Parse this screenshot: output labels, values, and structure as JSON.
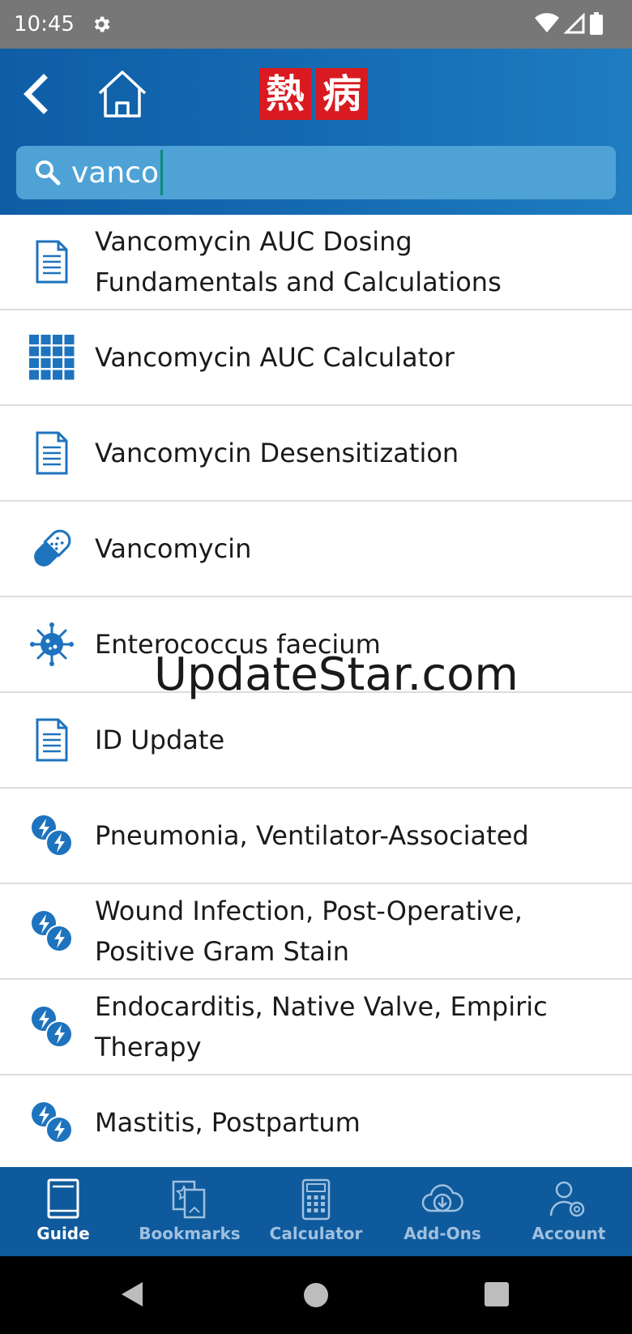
{
  "status_bar": {
    "time": "10:45"
  },
  "header": {
    "logo_chars": [
      "熱",
      "病"
    ],
    "search": {
      "value": "vanco"
    }
  },
  "results": [
    {
      "icon": "document-icon",
      "label": "Vancomycin AUC Dosing Fundamentals and Calculations"
    },
    {
      "icon": "calculator-grid-icon",
      "label": "Vancomycin AUC Calculator"
    },
    {
      "icon": "document-icon",
      "label": "Vancomycin Desensitization"
    },
    {
      "icon": "pill-icon",
      "label": "Vancomycin"
    },
    {
      "icon": "bacteria-icon",
      "label": "Enterococcus faecium"
    },
    {
      "icon": "document-icon",
      "label": "ID Update"
    },
    {
      "icon": "lightning-icon",
      "label": "Pneumonia, Ventilator-Associated"
    },
    {
      "icon": "lightning-icon",
      "label": "Wound Infection, Post-Operative, Positive Gram Stain"
    },
    {
      "icon": "lightning-icon",
      "label": "Endocarditis, Native Valve, Empiric Therapy"
    },
    {
      "icon": "lightning-icon",
      "label": "Mastitis, Postpartum"
    }
  ],
  "watermark": "UpdateStar.com",
  "bottom_nav": [
    {
      "icon": "book-icon",
      "label": "Guide",
      "active": true
    },
    {
      "icon": "bookmark-icon",
      "label": "Bookmarks",
      "active": false
    },
    {
      "icon": "calculator-icon",
      "label": "Calculator",
      "active": false
    },
    {
      "icon": "cloud-download-icon",
      "label": "Add-Ons",
      "active": false
    },
    {
      "icon": "account-gear-icon",
      "label": "Account",
      "active": false
    }
  ],
  "colors": {
    "header": "#1469b0",
    "nav": "#0e5a9c",
    "icon_blue": "#1e73be",
    "logo_red": "#d91a20"
  }
}
